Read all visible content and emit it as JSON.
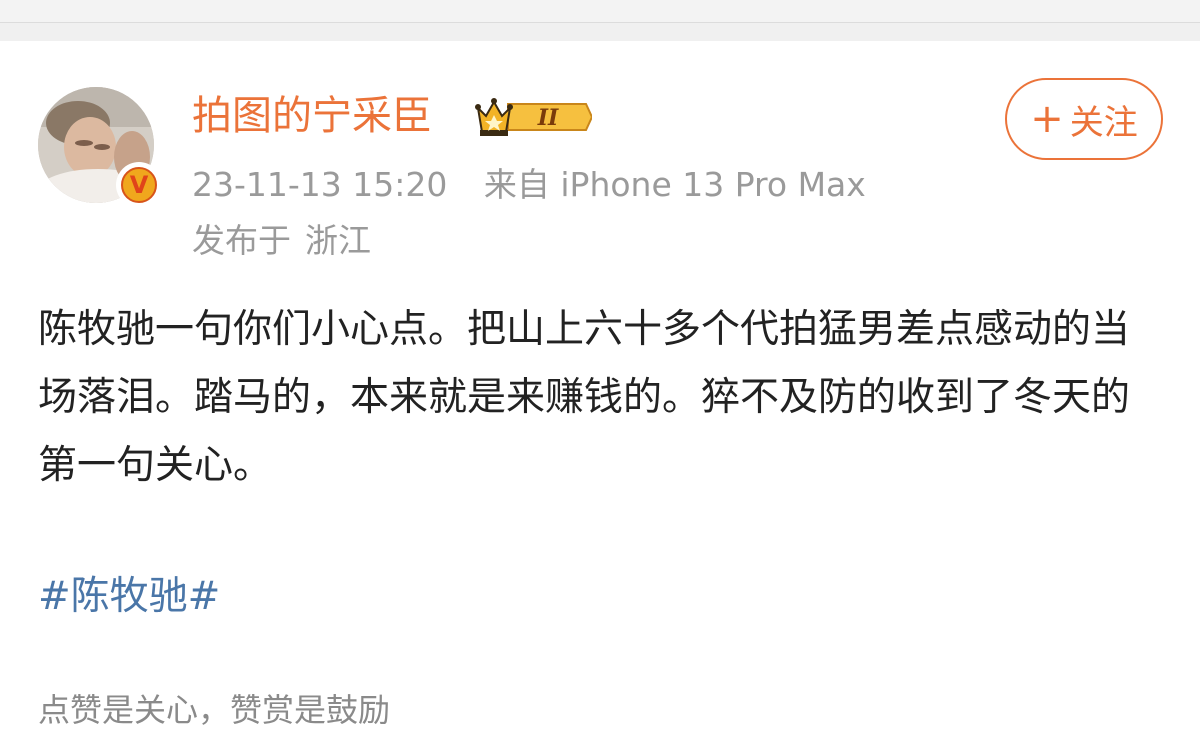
{
  "post": {
    "author": {
      "name": "拍图的宁采臣",
      "level_badge": "II",
      "avatar_icon": "avatar-photo",
      "verified_badge": "V"
    },
    "follow_button": {
      "plus": "+",
      "label": "关注"
    },
    "timestamp": "23-11-13 15:20",
    "source": "来自 iPhone 13 Pro Max",
    "location_prefix": "发布于",
    "location": "浙江",
    "content": "陈牧驰一句你们小心点。把山上六十多个代拍猛男差点感动的当场落泪。踏马的，本来就是来赚钱的。猝不及防的收到了冬天的第一句关心。",
    "hashtag": "#陈牧驰#",
    "next_preview": "点赞是关心，赞赏是鼓励"
  },
  "colors": {
    "accent": "#eb7339",
    "meta_gray": "#9a9a9a",
    "link_blue": "#4a76a8",
    "text": "#222222"
  }
}
